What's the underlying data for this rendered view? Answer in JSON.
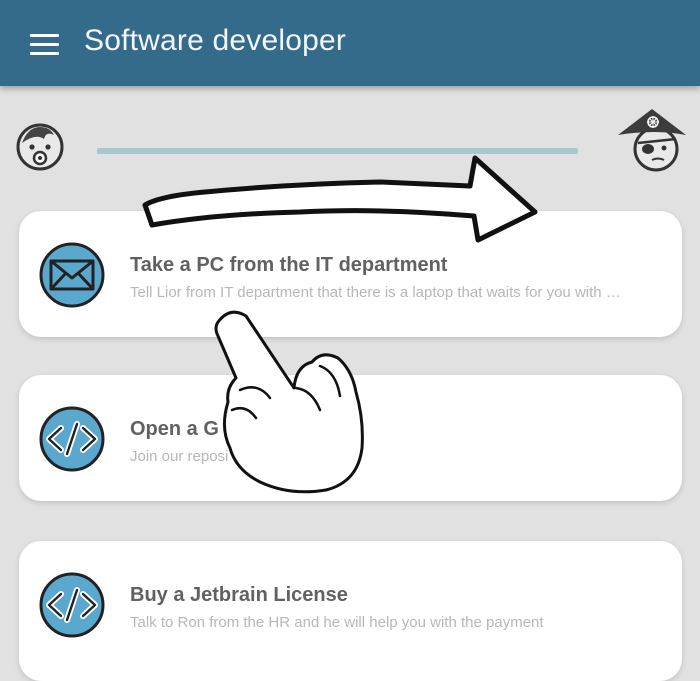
{
  "appbar": {
    "title": "Software developer",
    "menu_icon": "hamburger-menu-icon",
    "color": "#346b8a"
  },
  "progress": {
    "start_avatar": "baby-face-icon",
    "end_avatar": "pirate-face-icon",
    "value": 0
  },
  "tasks": [
    {
      "title": "Take a PC from the IT department",
      "subtitle": "Tell Lior from IT department that there is a laptop that waits for you with …",
      "icon": "envelope-icon"
    },
    {
      "title": "Open a G",
      "subtitle": "Join our reposi                     ael",
      "icon": "code-icon"
    },
    {
      "title": "Buy a Jetbrain License",
      "subtitle": "Talk to Ron from the HR and he will help you with the payment",
      "icon": "code-icon"
    }
  ],
  "overlay": {
    "arrow_icon": "swipe-arrow-icon",
    "hand_icon": "pointing-hand-icon"
  }
}
